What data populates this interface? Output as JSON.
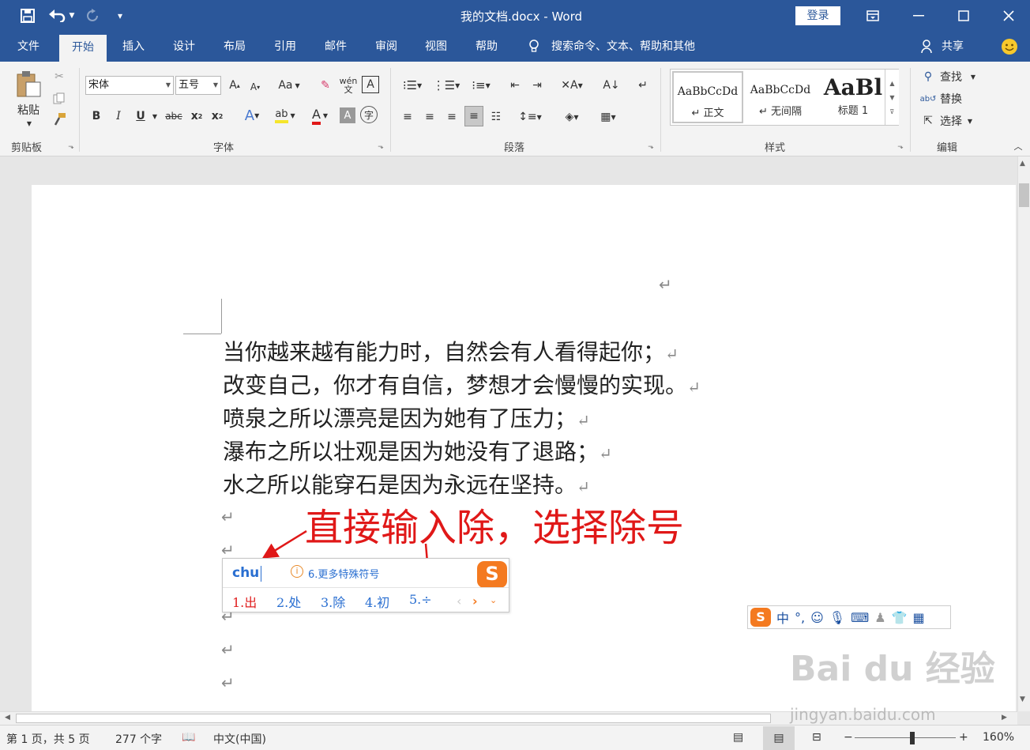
{
  "titlebar": {
    "doc_title": "我的文档.docx  -  Word",
    "login": "登录",
    "save_icon": "save-icon",
    "undo_icon": "undo-icon",
    "redo_icon": "redo-icon"
  },
  "tabs": [
    {
      "label": "文件"
    },
    {
      "label": "开始"
    },
    {
      "label": "插入"
    },
    {
      "label": "设计"
    },
    {
      "label": "布局"
    },
    {
      "label": "引用"
    },
    {
      "label": "邮件"
    },
    {
      "label": "审阅"
    },
    {
      "label": "视图"
    },
    {
      "label": "帮助"
    }
  ],
  "tellme": "搜索命令、文本、帮助和其他",
  "share": "共享",
  "ribbon": {
    "clipboard": {
      "paste": "粘贴",
      "group": "剪贴板"
    },
    "font": {
      "name": "宋体",
      "size": "五号",
      "group": "字体"
    },
    "paragraph": {
      "group": "段落"
    },
    "styles": {
      "group": "样式",
      "items": [
        {
          "preview": "AaBbCcDd",
          "label": "↵ 正文"
        },
        {
          "preview": "AaBbCcDd",
          "label": "↵ 无间隔"
        },
        {
          "preview": "AaBl",
          "label": "标题 1"
        }
      ]
    },
    "editing": {
      "find": "查找",
      "replace": "替换",
      "select": "选择",
      "group": "编辑"
    }
  },
  "document": {
    "lines": [
      "当你越来越有能力时，自然会有人看得起你；",
      "改变自己，你才有自信，梦想才会慢慢的实现。",
      "喷泉之所以漂亮是因为她有了压力；",
      "瀑布之所以壮观是因为她没有了退路；",
      "水之所以能穿石是因为永远在坚持。"
    ],
    "para_mark": "↵"
  },
  "ime": {
    "input": "chu",
    "hint": "6.更多特殊符号",
    "candidates": [
      "1.出",
      "2.处",
      "3.除",
      "4.初",
      "5.÷"
    ],
    "logo": "S",
    "toolbar": {
      "lang": "中",
      "punct": "°,"
    }
  },
  "annotation": "直接输入除，选择除号",
  "watermark": {
    "brand": "Bai du 经验",
    "url": "jingyan.baidu.com"
  },
  "status": {
    "page": "第 1 页，共 5 页",
    "words": "277 个字",
    "lang": "中文(中国)",
    "zoom": "160%"
  },
  "colors": {
    "brand": "#2b579a",
    "annotation": "#e01818",
    "ime_blue": "#2a6fd1",
    "sogou": "#f47a20"
  }
}
